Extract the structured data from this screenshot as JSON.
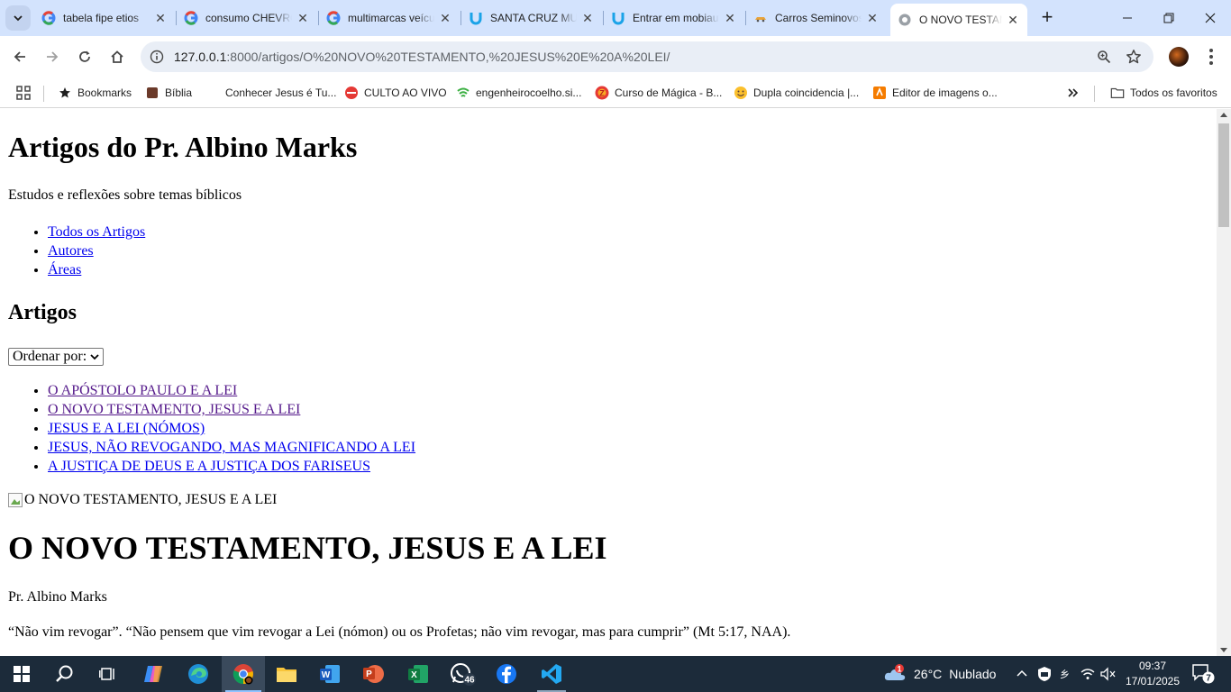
{
  "browser": {
    "tabs": [
      {
        "title": "tabela fipe etios",
        "favicon": "google-icon",
        "active": false
      },
      {
        "title": "consumo CHEVROLET",
        "favicon": "google-icon",
        "active": false
      },
      {
        "title": "multimarcas veículos",
        "favicon": "google-icon",
        "active": false
      },
      {
        "title": "SANTA CRUZ MULTIMARCAS",
        "favicon": "mobiauto-icon",
        "active": false
      },
      {
        "title": "Entrar em mobiauto",
        "favicon": "mobiauto-icon",
        "active": false
      },
      {
        "title": "Carros Seminovos",
        "favicon": "car-icon",
        "active": false
      },
      {
        "title": "O NOVO TESTAMENTO",
        "favicon": "globe-icon",
        "active": true
      }
    ],
    "url_host": "127.0.0.1",
    "url_rest": ":8000/artigos/O%20NOVO%20TESTAMENTO,%20JESUS%20E%20A%20LEI/",
    "bookmarks": [
      {
        "label": "Bookmarks",
        "icon": "star-icon"
      },
      {
        "label": "Bíblia",
        "icon": "book-icon"
      },
      {
        "label": "Conhecer Jesus é Tu...",
        "icon": ""
      },
      {
        "label": "CULTO AO VIVO",
        "icon": "live-icon"
      },
      {
        "label": "engenheirocoelho.si...",
        "icon": "wifi-icon"
      },
      {
        "label": "Curso de Mágica - B...",
        "icon": "magic-icon"
      },
      {
        "label": "Dupla coincidencia |...",
        "icon": "smiley-icon"
      },
      {
        "label": "Editor de imagens o...",
        "icon": "image-editor-icon"
      }
    ],
    "all_bookmarks": "Todos os favoritos"
  },
  "page": {
    "site_title": "Artigos do Pr. Albino Marks",
    "site_subtitle": "Estudos e reflexões sobre temas bíblicos",
    "nav": [
      "Todos os Artigos",
      "Autores",
      "Áreas"
    ],
    "section_title": "Artigos",
    "sort_label": "Ordenar por:",
    "articles": [
      {
        "title": "O APÓSTOLO PAULO E A LEI",
        "visited": true
      },
      {
        "title": "O NOVO TESTAMENTO, JESUS E A LEI",
        "visited": true
      },
      {
        "title": "JESUS E A LEI (NÓMOS)",
        "visited": false
      },
      {
        "title": "JESUS, NÃO REVOGANDO, MAS MAGNIFICANDO A LEI",
        "visited": false
      },
      {
        "title": "A JUSTIÇA DE DEUS E A JUSTIÇA DOS FARISEUS",
        "visited": false
      }
    ],
    "image_alt": "O NOVO TESTAMENTO, JESUS E A LEI",
    "article_title": "O NOVO TESTAMENTO, JESUS E A LEI",
    "article_author": "Pr. Albino Marks",
    "article_paragraph": "“Não vim revogar”. “Não pensem que vim revogar a Lei (nómon) ou os Profetas; não vim revogar, mas para cumprir” (Mt 5:17, NAA)."
  },
  "taskbar": {
    "apps": [
      "start-icon",
      "search-icon",
      "task-view-icon",
      "copilot-icon",
      "edge-icon",
      "chrome-icon",
      "file-explorer-icon",
      "word-icon",
      "powerpoint-icon",
      "excel-icon",
      "whatsapp-icon",
      "facebook-icon",
      "vscode-icon"
    ],
    "whatsapp_badge": "46",
    "weather_badge": "1",
    "weather_temp": "26°C",
    "weather_desc": "Nublado",
    "time": "09:37",
    "date": "17/01/2025",
    "notification_count": "7"
  },
  "colors": {
    "tabstrip_bg": "#d3e3fd",
    "link": "#0000ee",
    "visited_link": "#551a8b",
    "taskbar_bg": "#1c2b3a"
  }
}
